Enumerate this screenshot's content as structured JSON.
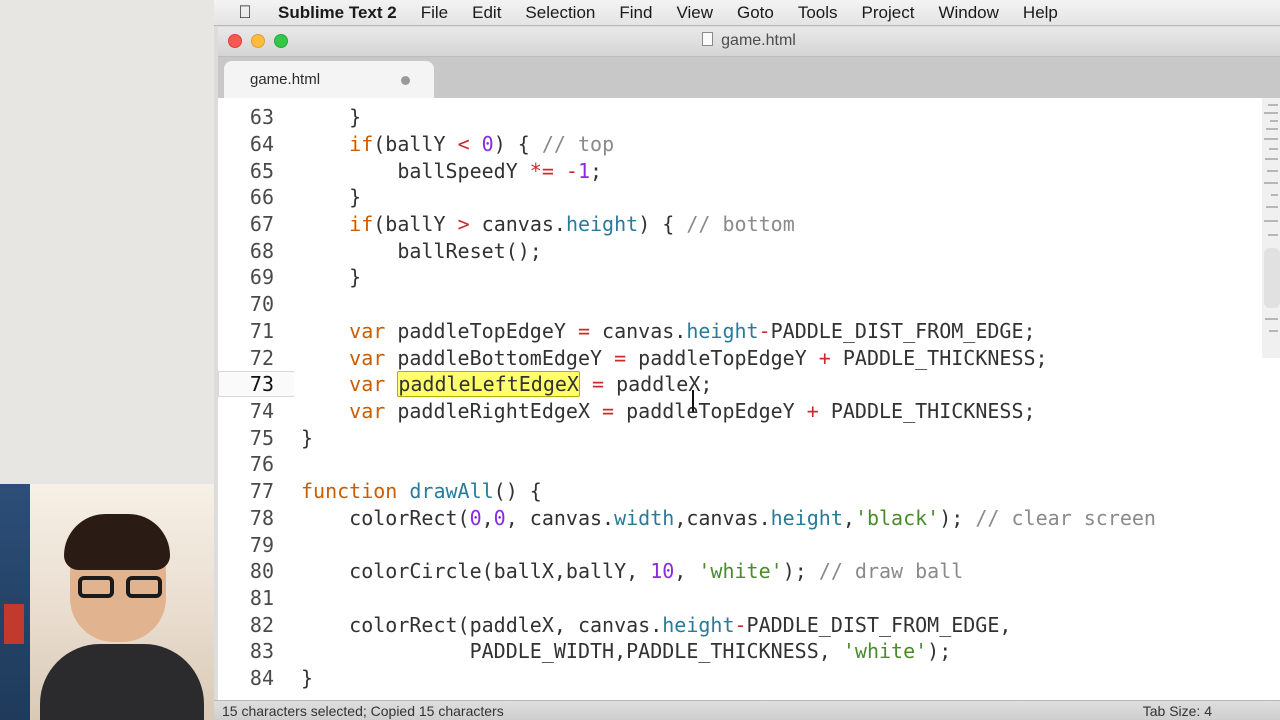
{
  "menubar": {
    "app_name": "Sublime Text 2",
    "items": [
      "File",
      "Edit",
      "Selection",
      "Find",
      "View",
      "Goto",
      "Tools",
      "Project",
      "Window",
      "Help"
    ]
  },
  "window": {
    "title": "game.html"
  },
  "tabs": [
    {
      "label": "game.html",
      "dirty": true
    }
  ],
  "editor": {
    "active_line": 73,
    "lines": [
      {
        "n": "63",
        "text": "    }"
      },
      {
        "n": "64",
        "text": "    if(ballY < 0) { // top"
      },
      {
        "n": "65",
        "text": "        ballSpeedY *= -1;"
      },
      {
        "n": "66",
        "text": "    }"
      },
      {
        "n": "67",
        "text": "    if(ballY > canvas.height) { // bottom"
      },
      {
        "n": "68",
        "text": "        ballReset();"
      },
      {
        "n": "69",
        "text": "    }"
      },
      {
        "n": "70",
        "text": ""
      },
      {
        "n": "71",
        "text": "    var paddleTopEdgeY = canvas.height-PADDLE_DIST_FROM_EDGE;"
      },
      {
        "n": "72",
        "text": "    var paddleBottomEdgeY = paddleTopEdgeY + PADDLE_THICKNESS;"
      },
      {
        "n": "73",
        "text": "    var paddleLeftEdgeX = paddleX;"
      },
      {
        "n": "74",
        "text": "    var paddleRightEdgeX = paddleTopEdgeY + PADDLE_THICKNESS;"
      },
      {
        "n": "75",
        "text": "}"
      },
      {
        "n": "76",
        "text": ""
      },
      {
        "n": "77",
        "text": "function drawAll() {"
      },
      {
        "n": "78",
        "text": "    colorRect(0,0, canvas.width,canvas.height,'black'); // clear screen"
      },
      {
        "n": "79",
        "text": ""
      },
      {
        "n": "80",
        "text": "    colorCircle(ballX,ballY, 10, 'white'); // draw ball"
      },
      {
        "n": "81",
        "text": ""
      },
      {
        "n": "82",
        "text": "    colorRect(paddleX, canvas.height-PADDLE_DIST_FROM_EDGE,"
      },
      {
        "n": "83",
        "text": "              PADDLE_WIDTH,PADDLE_THICKNESS, 'white');"
      },
      {
        "n": "84",
        "text": "}"
      }
    ],
    "selected_text": "paddleLeftEdgeX"
  },
  "statusbar": {
    "message": "15 characters selected; Copied 15 characters",
    "tab_size": "Tab Size: 4"
  },
  "colors": {
    "keyword": "#cc5c00",
    "selection": "#ffff6b",
    "close": "#fc5753",
    "minimize": "#fdbc40",
    "maximize": "#33c748"
  }
}
